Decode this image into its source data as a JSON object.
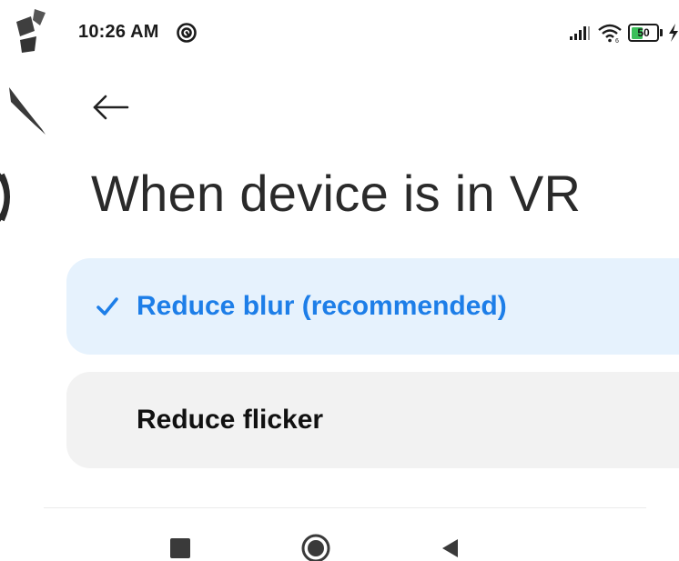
{
  "status_bar": {
    "time": "10:26 AM",
    "battery_level": "50",
    "icons": [
      "hotspot-icon",
      "signal-icon",
      "wifi-icon",
      "battery-icon",
      "charging-bolt-icon"
    ]
  },
  "header": {
    "back_icon": "arrow-left-icon",
    "title": "When device is in VR"
  },
  "options": [
    {
      "label": "Reduce blur (recommended)",
      "selected": true
    },
    {
      "label": "Reduce flicker",
      "selected": false
    }
  ],
  "nav_bar": {
    "icons": [
      "recents-square-icon",
      "home-circle-icon",
      "back-triangle-icon"
    ]
  },
  "colors": {
    "accent": "#1d7ee8",
    "selected_bg": "#e6f2fd",
    "unselected_bg": "#f2f2f2",
    "battery_green": "#3bbf5a"
  }
}
